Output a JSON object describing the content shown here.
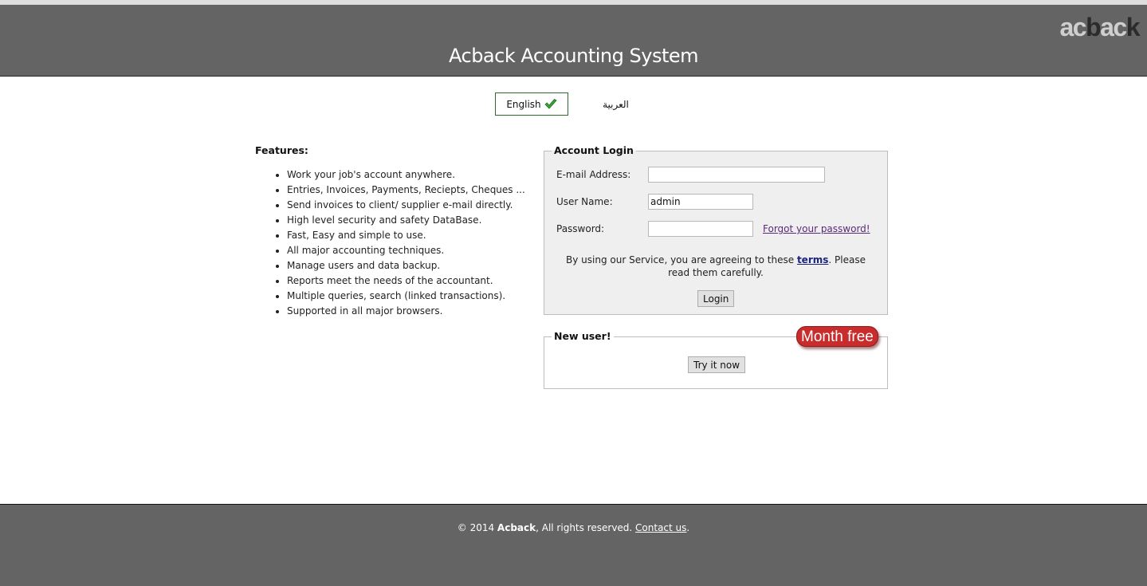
{
  "header": {
    "title": "Acback Accounting System",
    "logo": {
      "part1": "ac",
      "part2": "b",
      "part3": "ac",
      "part4": "k"
    }
  },
  "language": {
    "english_label": "English",
    "arabic_label": "العربية",
    "selected": "English",
    "check_color": "#3aa33a"
  },
  "features": {
    "heading": "Features:",
    "items": [
      "Work your job's account anywhere.",
      "Entries, Invoices, Payments, Reciepts, Cheques ...",
      "Send invoices to client/ supplier e-mail directly.",
      "High level security and safety DataBase.",
      "Fast, Easy and simple to use.",
      "All major accounting techniques.",
      "Manage users and data backup.",
      "Reports meet the needs of the accountant.",
      "Multiple queries, search (linked transactions).",
      "Supported in all major browsers."
    ]
  },
  "login": {
    "legend": "Account Login",
    "email_label": "E-mail Address:",
    "email_value": "",
    "username_label": "User Name:",
    "username_value": "admin",
    "password_label": "Password:",
    "password_value": "",
    "forgot_link": "Forgot your password!",
    "terms_prefix": "By using our Service, you are agreeing to these ",
    "terms_link": "terms",
    "terms_suffix": ". Please read them carefully.",
    "login_button": "Login"
  },
  "new_user": {
    "legend": "New user!",
    "badge": "Month free",
    "badge_color": "#c82c2c",
    "try_button": "Try it now"
  },
  "footer": {
    "copyright": "© 2014 ",
    "brand": "Acback",
    "rights": ", All rights reserved. ",
    "contact_link": "Contact us",
    "end": "."
  }
}
